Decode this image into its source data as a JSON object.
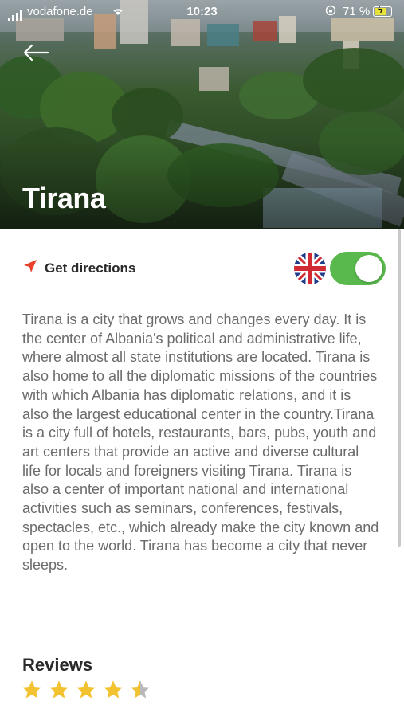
{
  "status_bar": {
    "carrier": "vodafone.de",
    "time": "10:23",
    "battery": "71 %"
  },
  "header": {
    "title": "Tirana"
  },
  "actions": {
    "directions_label": "Get directions",
    "language_flag": "uk-flag-icon",
    "toggle_on": true
  },
  "description": "Tirana is a city that grows and changes every day. It is the center of Albania's political and administrative life, where almost all state institutions are located. Tirana is also home to all the diplomatic missions of the countries with which Albania has diplomatic relations, and it is also the largest educational center in the country.Tirana is a city full of hotels, restaurants, bars, pubs, youth and art centers that provide an active and diverse cultural life for locals and foreigners visiting Tirana. Tirana is also a center of important national and international activities such as seminars, conferences, festivals, spectacles, etc., which already make the city known and open to the world. Tirana has become a city that never sleeps.",
  "reviews": {
    "heading": "Reviews",
    "rating": 4.5,
    "max": 5
  },
  "colors": {
    "accent_green": "#5ab94d",
    "star_gold": "#f2c230",
    "star_grey": "#b8b8b8",
    "direction_red": "#e8432a"
  }
}
